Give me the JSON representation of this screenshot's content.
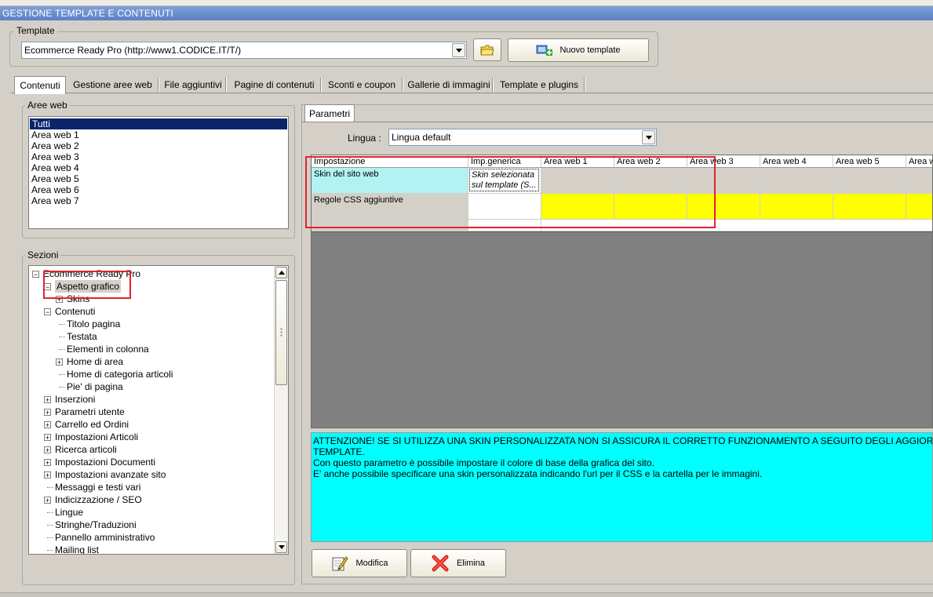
{
  "window": {
    "title": "GESTIONE TEMPLATE E CONTENUTI"
  },
  "template_group": {
    "label": "Template",
    "selected": "Ecommerce Ready Pro (http://www1.CODICE.IT/T/)",
    "new_button": "Nuovo template"
  },
  "tabs": [
    "Contenuti",
    "Gestione aree web",
    "File aggiuntivi",
    "Pagine di contenuti",
    "Sconti e coupon",
    "Gallerie di immagini",
    "Template e plugins"
  ],
  "areas": {
    "label": "Aree web",
    "items": [
      "Tutti",
      "Area web 1",
      "Area web 2",
      "Area web 3",
      "Area web 4",
      "Area web 5",
      "Area web 6",
      "Area web 7"
    ]
  },
  "sections": {
    "label": "Sezioni",
    "tree": [
      {
        "label": "Ecommerce Ready Pro",
        "exp": "−"
      },
      {
        "label": "Aspetto grafico",
        "exp": "−"
      },
      {
        "label": "Skins",
        "exp": "+"
      },
      {
        "label": "Contenuti",
        "exp": "−"
      },
      {
        "label": "Titolo pagina",
        "exp": ""
      },
      {
        "label": "Testata",
        "exp": ""
      },
      {
        "label": "Elementi in colonna",
        "exp": ""
      },
      {
        "label": "Home di area",
        "exp": "+"
      },
      {
        "label": "Home di categoria articoli",
        "exp": ""
      },
      {
        "label": "Pie' di pagina",
        "exp": ""
      },
      {
        "label": "Inserzioni",
        "exp": "+"
      },
      {
        "label": "Parametri utente",
        "exp": "+"
      },
      {
        "label": "Carrello ed Ordini",
        "exp": "+"
      },
      {
        "label": "Impostazioni Articoli",
        "exp": "+"
      },
      {
        "label": "Ricerca articoli",
        "exp": "+"
      },
      {
        "label": "Impostazioni Documenti",
        "exp": "+"
      },
      {
        "label": "Impostazioni avanzate sito",
        "exp": "+"
      },
      {
        "label": "Messaggi e testi vari",
        "exp": ""
      },
      {
        "label": "Indicizzazione / SEO",
        "exp": "+"
      },
      {
        "label": "Lingue",
        "exp": ""
      },
      {
        "label": "Stringhe/Traduzioni",
        "exp": ""
      },
      {
        "label": "Pannello amministrativo",
        "exp": ""
      },
      {
        "label": "Mailing list",
        "exp": ""
      }
    ]
  },
  "params": {
    "tab": "Parametri",
    "lang_label": "Lingua :",
    "lang_value": "Lingua default",
    "columns": [
      "Impostazione",
      "Imp.generica",
      "Area web 1",
      "Area web 2",
      "Area web 3",
      "Area web 4",
      "Area web 5",
      "Area w"
    ],
    "rows": [
      {
        "name": "Skin del sito web",
        "generic": "Skin selezionata sul template (S..."
      },
      {
        "name": "Regole CSS aggiuntive",
        "generic": ""
      }
    ],
    "info": [
      "ATTENZIONE! SE SI UTILIZZA UNA SKIN PERSONALIZZATA NON SI ASSICURA IL CORRETTO FUNZIONAMENTO A SEGUITO DEGLI AGGIORNAM",
      "TEMPLATE.",
      "Con questo parametro è possibile impostare il colore di base della grafica del sito.",
      "E' anche possibile specificare una skin personalizzata indicando l'url per il CSS e la cartella per le immagini."
    ],
    "modify_button": "Modifica",
    "delete_button": "Elimina"
  },
  "colors": {
    "skin_row_bg": "#b2f2f2",
    "css_row_bg": "#ffff00",
    "info_bg": "#00ffff",
    "grid_empty_bg": "#808080",
    "highlight_border": "#e0232e",
    "selection_bg": "#0a246a"
  }
}
